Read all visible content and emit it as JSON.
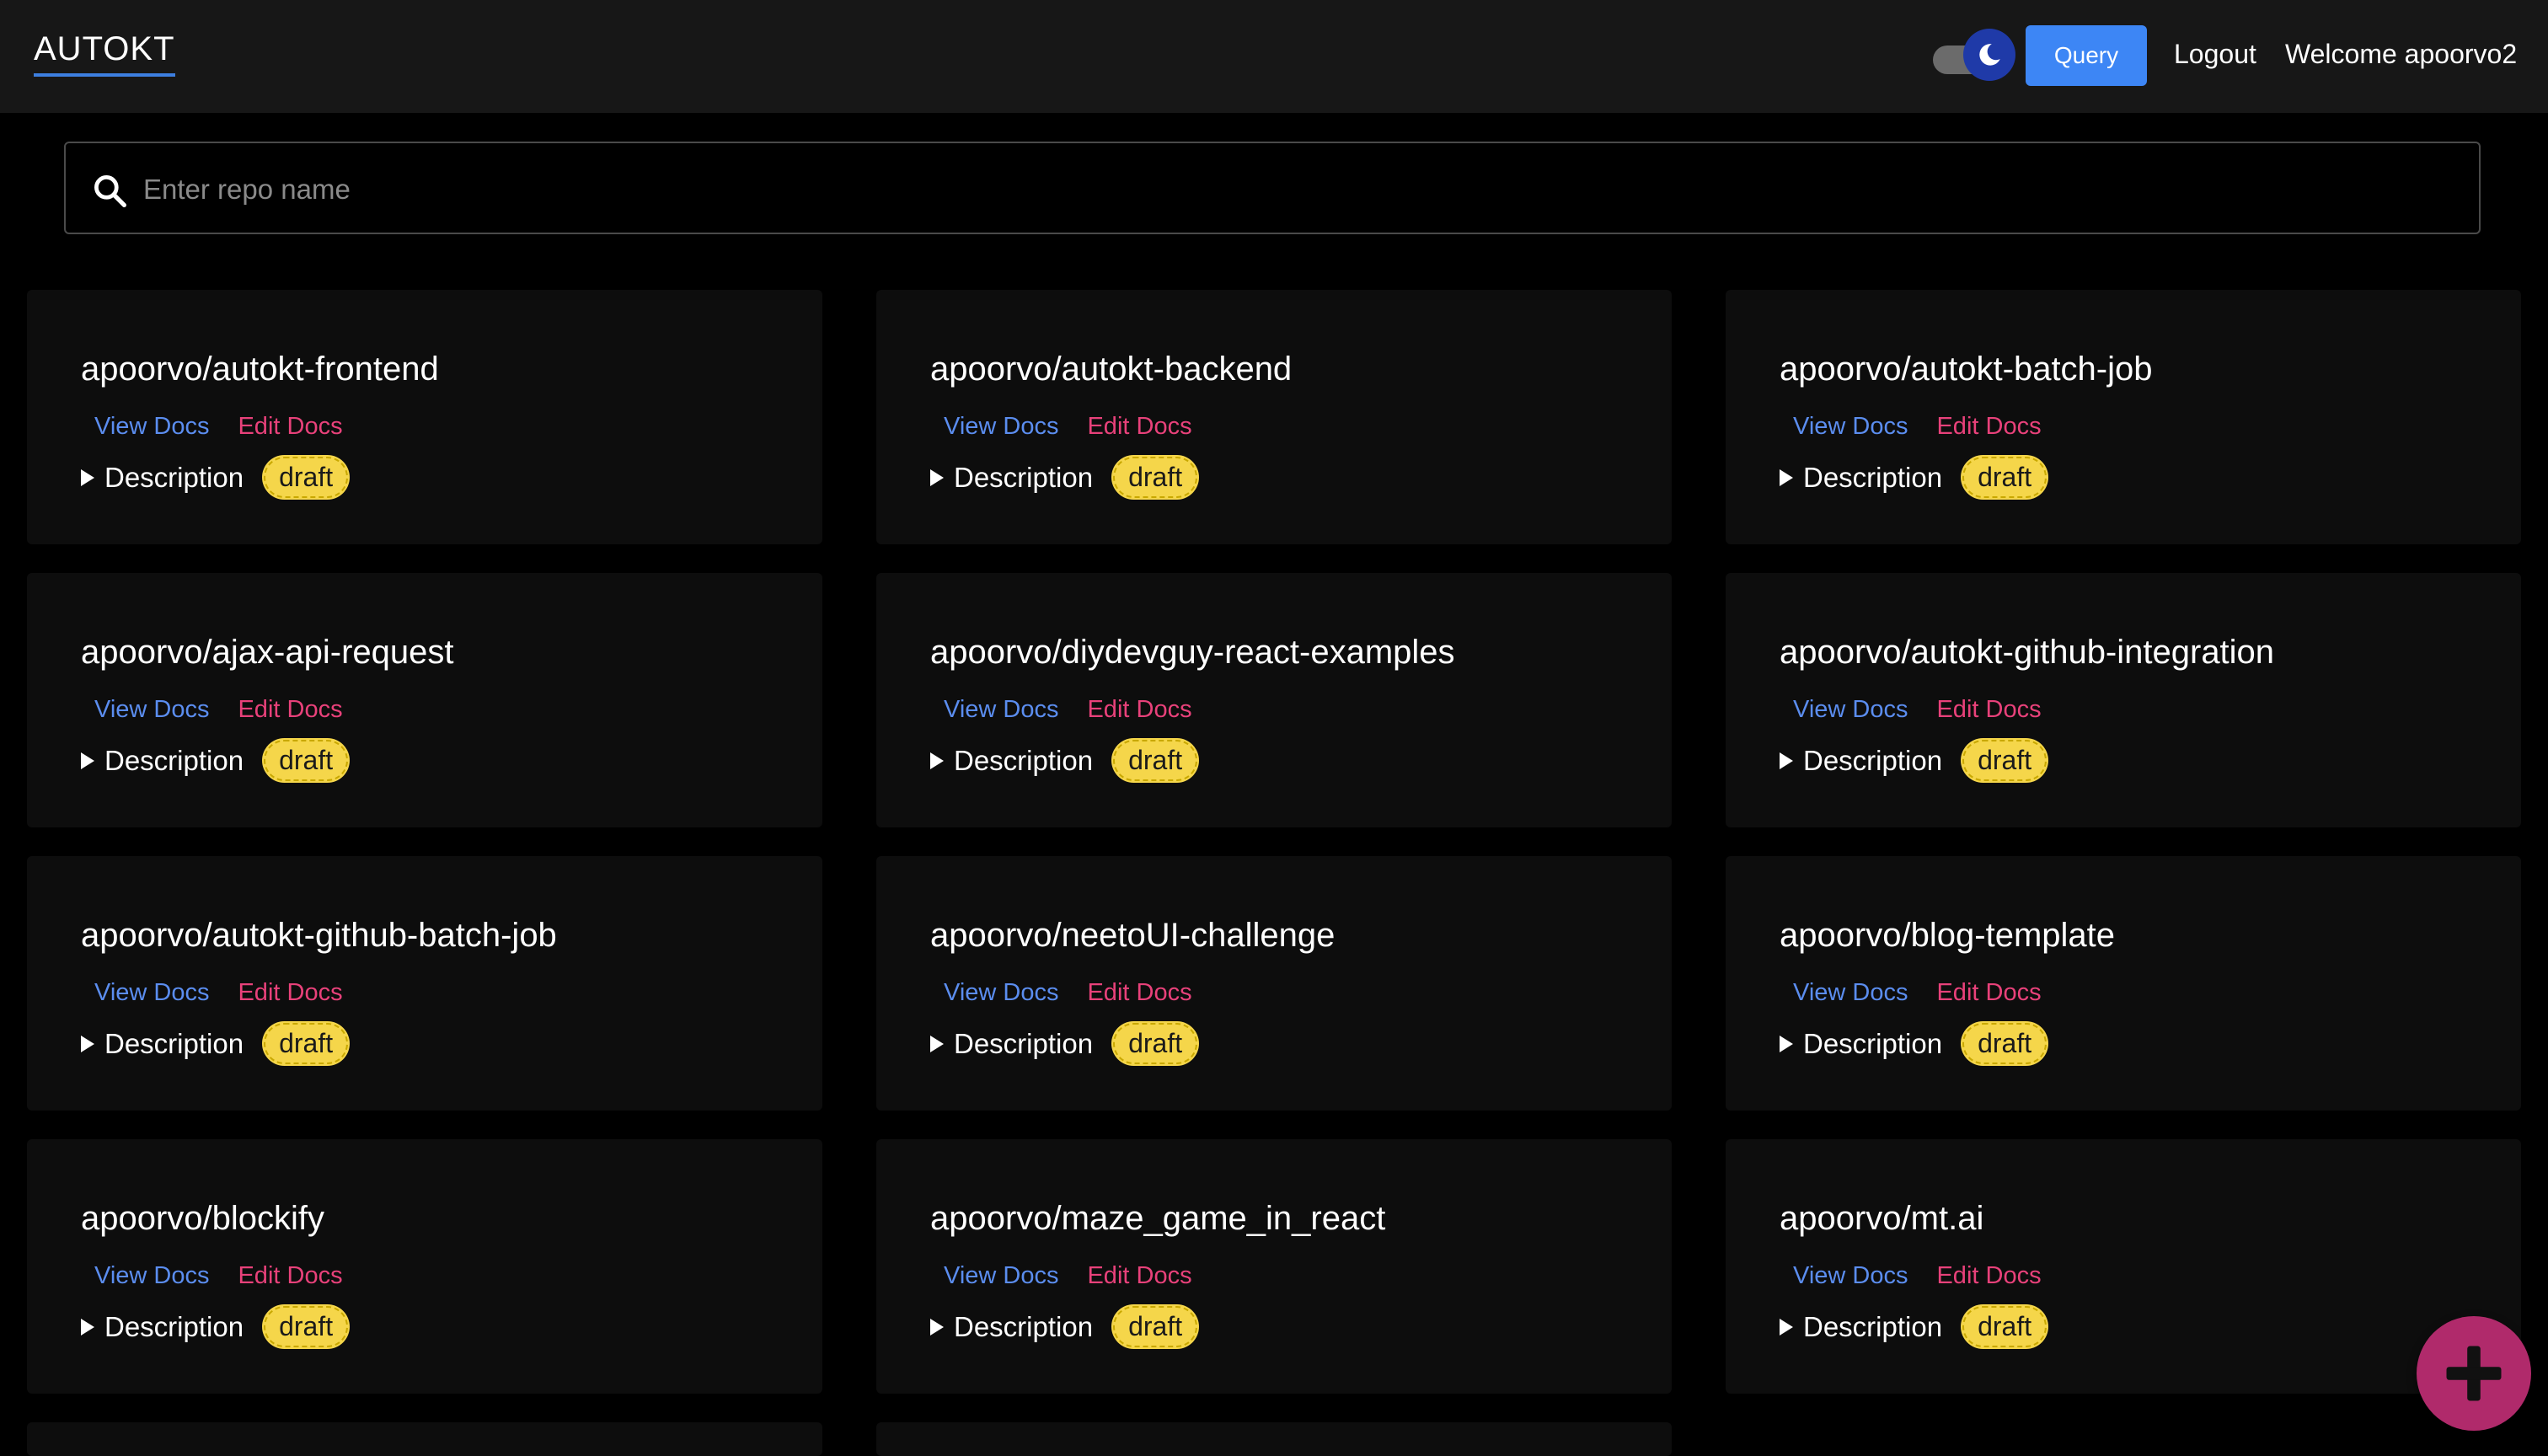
{
  "header": {
    "brand": "AUTOKT",
    "theme_toggle_icon": "moon-icon",
    "query_label": "Query",
    "logout_label": "Logout",
    "welcome_text": "Welcome apoorvo2",
    "accent_color": "#3d86f5"
  },
  "search": {
    "icon": "search-icon",
    "placeholder": "Enter repo name",
    "value": ""
  },
  "repos": [
    {
      "name": "apoorvo/autokt-frontend",
      "view_label": "View Docs",
      "edit_label": "Edit Docs",
      "description_label": "Description",
      "status": "draft"
    },
    {
      "name": "apoorvo/autokt-backend",
      "view_label": "View Docs",
      "edit_label": "Edit Docs",
      "description_label": "Description",
      "status": "draft"
    },
    {
      "name": "apoorvo/autokt-batch-job",
      "view_label": "View Docs",
      "edit_label": "Edit Docs",
      "description_label": "Description",
      "status": "draft"
    },
    {
      "name": "apoorvo/ajax-api-request",
      "view_label": "View Docs",
      "edit_label": "Edit Docs",
      "description_label": "Description",
      "status": "draft"
    },
    {
      "name": "apoorvo/diydevguy-react-examples",
      "view_label": "View Docs",
      "edit_label": "Edit Docs",
      "description_label": "Description",
      "status": "draft"
    },
    {
      "name": "apoorvo/autokt-github-integration",
      "view_label": "View Docs",
      "edit_label": "Edit Docs",
      "description_label": "Description",
      "status": "draft"
    },
    {
      "name": "apoorvo/autokt-github-batch-job",
      "view_label": "View Docs",
      "edit_label": "Edit Docs",
      "description_label": "Description",
      "status": "draft"
    },
    {
      "name": "apoorvo/neetoUI-challenge",
      "view_label": "View Docs",
      "edit_label": "Edit Docs",
      "description_label": "Description",
      "status": "draft"
    },
    {
      "name": "apoorvo/blog-template",
      "view_label": "View Docs",
      "edit_label": "Edit Docs",
      "description_label": "Description",
      "status": "draft"
    },
    {
      "name": "apoorvo/blockify",
      "view_label": "View Docs",
      "edit_label": "Edit Docs",
      "description_label": "Description",
      "status": "draft"
    },
    {
      "name": "apoorvo/maze_game_in_react",
      "view_label": "View Docs",
      "edit_label": "Edit Docs",
      "description_label": "Description",
      "status": "draft"
    },
    {
      "name": "apoorvo/mt.ai",
      "view_label": "View Docs",
      "edit_label": "Edit Docs",
      "description_label": "Description",
      "status": "draft"
    }
  ],
  "colors": {
    "view_link": "#5b8def",
    "edit_link": "#e8417a",
    "draft_badge": "#f5d64a",
    "fab": "#b02a6b"
  },
  "fab": {
    "icon": "plus-icon"
  }
}
